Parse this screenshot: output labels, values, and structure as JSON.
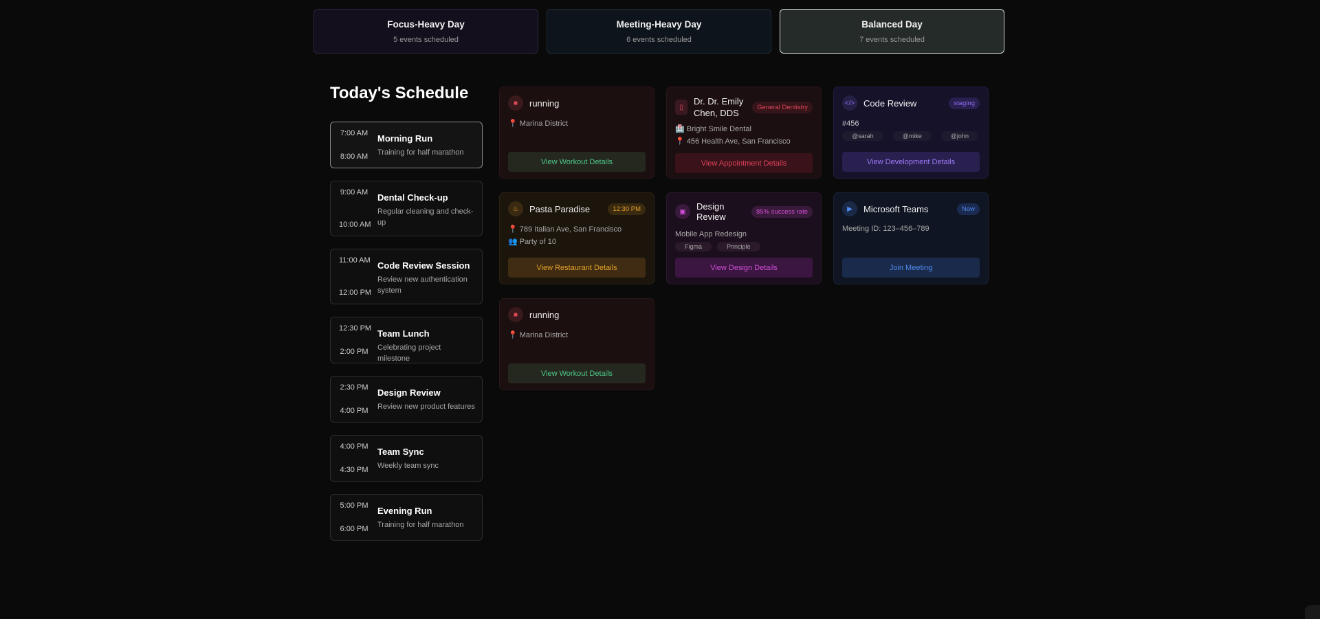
{
  "tabs": [
    {
      "title": "Focus-Heavy Day",
      "subtitle": "5 events scheduled"
    },
    {
      "title": "Meeting-Heavy Day",
      "subtitle": "6 events scheduled"
    },
    {
      "title": "Balanced Day",
      "subtitle": "7 events scheduled"
    }
  ],
  "schedule": {
    "title": "Today's Schedule",
    "items": [
      {
        "start": "7:00 AM",
        "end": "8:00 AM",
        "name": "Morning Run",
        "desc": "Training for half marathon"
      },
      {
        "start": "9:00 AM",
        "end": "10:00 AM",
        "name": "Dental Check-up",
        "desc": "Regular cleaning and check-up"
      },
      {
        "start": "11:00 AM",
        "end": "12:00 PM",
        "name": "Code Review Session",
        "desc": "Review new authentication system"
      },
      {
        "start": "12:30 PM",
        "end": "2:00 PM",
        "name": "Team Lunch",
        "desc": "Celebrating project milestone"
      },
      {
        "start": "2:30 PM",
        "end": "4:00 PM",
        "name": "Design Review",
        "desc": "Review new product features"
      },
      {
        "start": "4:00 PM",
        "end": "4:30 PM",
        "name": "Team Sync",
        "desc": "Weekly team sync"
      },
      {
        "start": "5:00 PM",
        "end": "6:00 PM",
        "name": "Evening Run",
        "desc": "Training for half marathon"
      }
    ]
  },
  "cards": {
    "run1": {
      "title": "running",
      "location": "📍 Marina District",
      "button": "View Workout Details"
    },
    "dental": {
      "title": "Dr. Dr. Emily Chen, DDS",
      "badge": "General Dentistry",
      "clinic": "🏥 Bright Smile Dental",
      "address": "📍 456 Health Ave, San Francisco",
      "button": "View Appointment Details"
    },
    "code": {
      "title": "Code Review",
      "badge": "staging",
      "pr": "#456",
      "reviewers": [
        "@sarah",
        "@mike",
        "@john"
      ],
      "button": "View Development Details"
    },
    "pasta": {
      "title": "Pasta Paradise",
      "badge": "12:30 PM",
      "address": "📍 789 Italian Ave, San Francisco",
      "party": "👥 Party of 10",
      "button": "View Restaurant Details"
    },
    "design": {
      "title": "Design Review",
      "badge": "85% success rate",
      "project": "Mobile App Redesign",
      "tools": [
        "Figma",
        "Principle"
      ],
      "button": "View Design Details"
    },
    "teams": {
      "title": "Microsoft Teams",
      "badge": "Now",
      "meeting": "Meeting ID: 123–456–789",
      "button": "Join Meeting"
    },
    "run2": {
      "title": "running",
      "location": "📍 Marina District",
      "button": "View Workout Details"
    }
  },
  "colors": {
    "workout_accent": "#4fc98a",
    "dental_accent": "#e0435a",
    "dev_accent": "#8b6cf0",
    "food_accent": "#e5a12a",
    "design_accent": "#d24fd8",
    "teams_accent": "#4f8cf0"
  }
}
